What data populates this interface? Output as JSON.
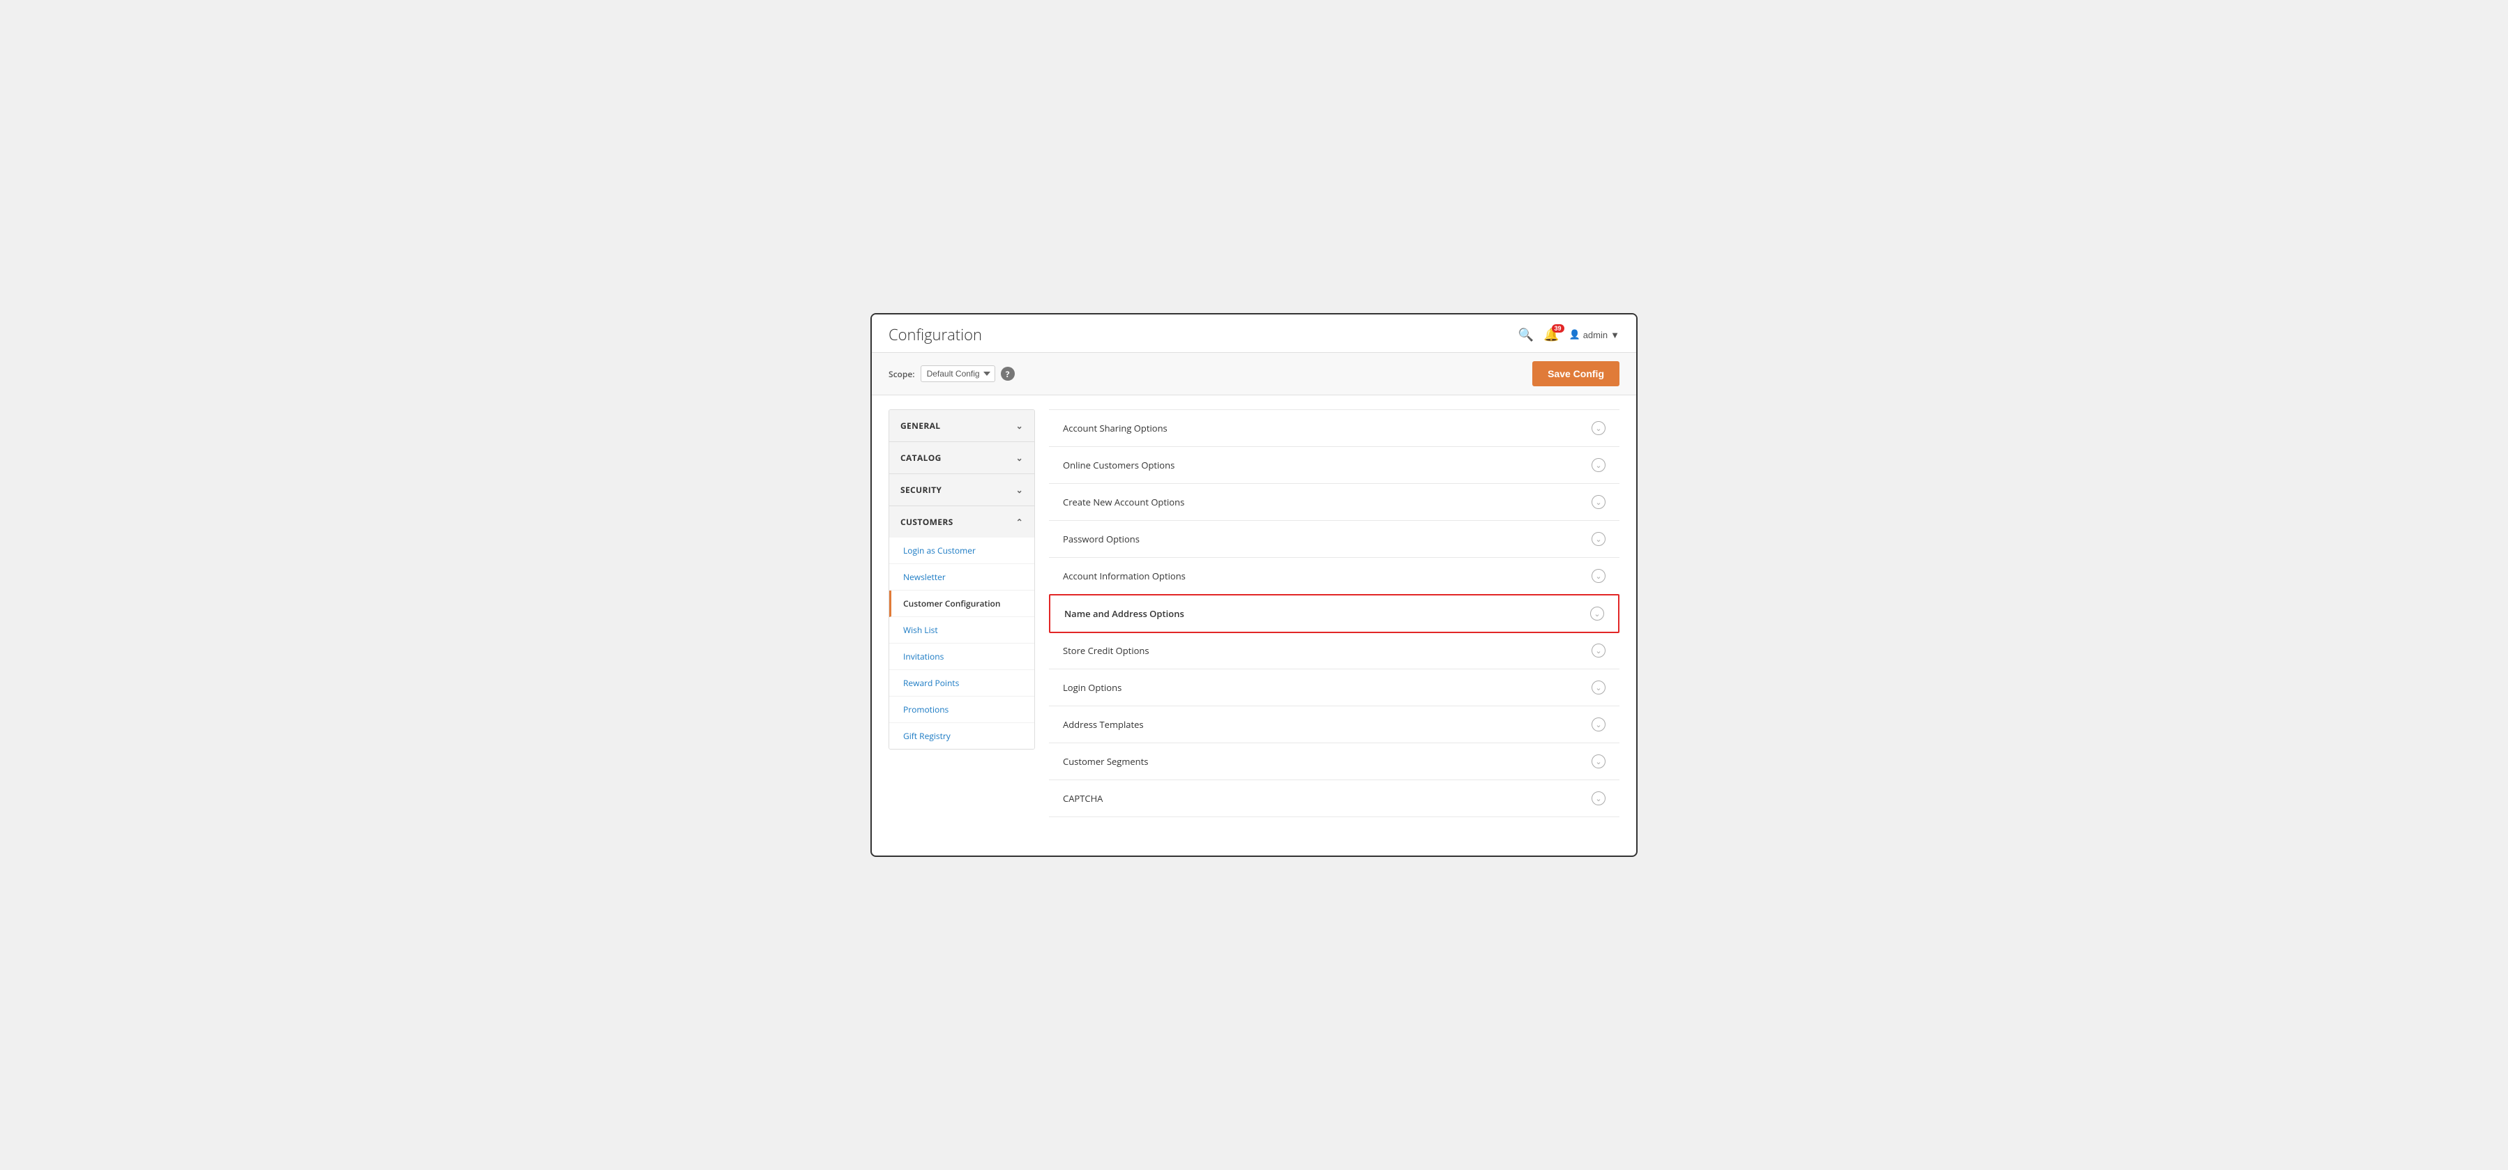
{
  "header": {
    "title": "Configuration",
    "search_icon": "🔍",
    "notification_count": "39",
    "user_icon": "👤",
    "user_name": "admin"
  },
  "scope_bar": {
    "scope_label": "Scope:",
    "scope_value": "Default Config",
    "help_icon": "?",
    "save_button_label": "Save Config"
  },
  "sidebar": {
    "sections": [
      {
        "id": "general",
        "label": "GENERAL",
        "expanded": false,
        "items": []
      },
      {
        "id": "catalog",
        "label": "CATALOG",
        "expanded": false,
        "items": []
      },
      {
        "id": "security",
        "label": "SECURITY",
        "expanded": false,
        "items": []
      },
      {
        "id": "customers",
        "label": "CUSTOMERS",
        "expanded": true,
        "items": [
          {
            "id": "login-as-customer",
            "label": "Login as Customer",
            "active": false
          },
          {
            "id": "newsletter",
            "label": "Newsletter",
            "active": false
          },
          {
            "id": "customer-configuration",
            "label": "Customer Configuration",
            "active": true
          },
          {
            "id": "wish-list",
            "label": "Wish List",
            "active": false
          },
          {
            "id": "invitations",
            "label": "Invitations",
            "active": false
          },
          {
            "id": "reward-points",
            "label": "Reward Points",
            "active": false
          },
          {
            "id": "promotions",
            "label": "Promotions",
            "active": false
          },
          {
            "id": "gift-registry",
            "label": "Gift Registry",
            "active": false
          }
        ]
      }
    ]
  },
  "config_rows": [
    {
      "id": "account-sharing-options",
      "label": "Account Sharing Options",
      "highlighted": false
    },
    {
      "id": "online-customers-options",
      "label": "Online Customers Options",
      "highlighted": false
    },
    {
      "id": "create-new-account-options",
      "label": "Create New Account Options",
      "highlighted": false
    },
    {
      "id": "password-options",
      "label": "Password Options",
      "highlighted": false
    },
    {
      "id": "account-information-options",
      "label": "Account Information Options",
      "highlighted": false
    },
    {
      "id": "name-and-address-options",
      "label": "Name and Address Options",
      "highlighted": true
    },
    {
      "id": "store-credit-options",
      "label": "Store Credit Options",
      "highlighted": false
    },
    {
      "id": "login-options",
      "label": "Login Options",
      "highlighted": false
    },
    {
      "id": "address-templates",
      "label": "Address Templates",
      "highlighted": false
    },
    {
      "id": "customer-segments",
      "label": "Customer Segments",
      "highlighted": false
    },
    {
      "id": "captcha",
      "label": "CAPTCHA",
      "highlighted": false
    }
  ]
}
